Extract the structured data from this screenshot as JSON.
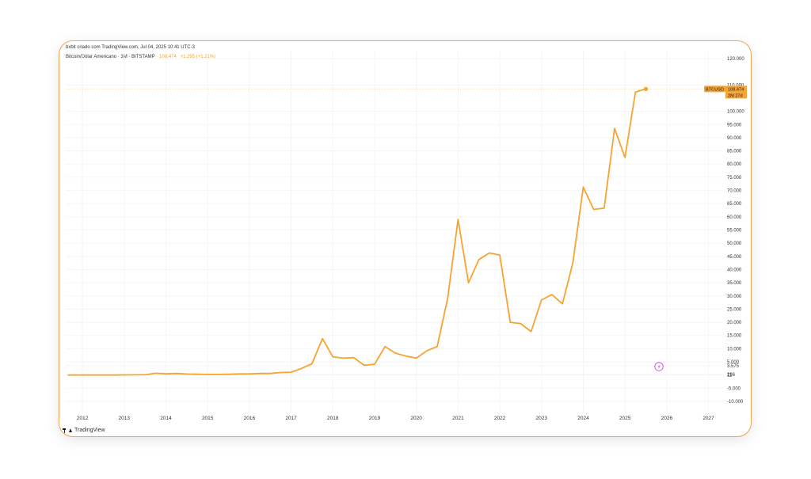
{
  "header": {
    "created": "bxbit criado com TradingView.com, Jul 04, 2025 10:41 UTC-3",
    "symbol_desc": "Bitcoin/Dólar Americano · 3M · BITSTAMP",
    "price": "108.474",
    "change": "+1.295 (+1.21%)"
  },
  "badge": {
    "symbol": "BTCUSD",
    "price": "108.474",
    "countdown": "2M 27d"
  },
  "brand": "TradingView",
  "colors": {
    "series": "#f7a330",
    "grid": "#f2f3f5",
    "badge_bg": "#f7a330",
    "card_border": "#f0a55a"
  },
  "icons": {
    "flash": "lightning-icon"
  },
  "chart_data": {
    "type": "line",
    "x_ticks": [
      "2012",
      "2013",
      "2014",
      "2015",
      "2016",
      "2017",
      "2018",
      "2019",
      "2020",
      "2021",
      "2022",
      "2023",
      "2024",
      "2025",
      "2026",
      "2027"
    ],
    "y_ticks": [
      "120.000",
      "110.000",
      "100.000",
      "95.000",
      "90.000",
      "85.000",
      "80.000",
      "75.000",
      "70.000",
      "65.000",
      "60.000",
      "55.000",
      "50.000",
      "45.000",
      "40.000",
      "35.000",
      "30.000",
      "25.000",
      "20.000",
      "15.000",
      "10.000",
      "5.000",
      "3.575",
      "236",
      "11",
      "-5.000",
      "-10.000"
    ],
    "xlim": [
      2011.6,
      2027.35
    ],
    "ylim": [
      -13000,
      123000
    ],
    "series": [
      {
        "values": [
          [
            2011.65,
            5
          ],
          [
            2012.0,
            5
          ],
          [
            2012.25,
            5
          ],
          [
            2012.5,
            7
          ],
          [
            2012.75,
            10
          ],
          [
            2013.0,
            50
          ],
          [
            2013.25,
            100
          ],
          [
            2013.5,
            100
          ],
          [
            2013.75,
            700
          ],
          [
            2014.0,
            450
          ],
          [
            2014.25,
            600
          ],
          [
            2014.5,
            400
          ],
          [
            2014.75,
            300
          ],
          [
            2015.0,
            250
          ],
          [
            2015.25,
            240
          ],
          [
            2015.5,
            300
          ],
          [
            2015.75,
            420
          ],
          [
            2016.0,
            430
          ],
          [
            2016.25,
            600
          ],
          [
            2016.5,
            600
          ],
          [
            2016.75,
            960
          ],
          [
            2017.0,
            1070
          ],
          [
            2017.25,
            2500
          ],
          [
            2017.5,
            4300
          ],
          [
            2017.75,
            13800
          ],
          [
            2018.0,
            6900
          ],
          [
            2018.25,
            6400
          ],
          [
            2018.5,
            6600
          ],
          [
            2018.75,
            3700
          ],
          [
            2019.0,
            4100
          ],
          [
            2019.25,
            10800
          ],
          [
            2019.5,
            8300
          ],
          [
            2019.75,
            7200
          ],
          [
            2020.0,
            6400
          ],
          [
            2020.25,
            9200
          ],
          [
            2020.5,
            10800
          ],
          [
            2020.75,
            29000
          ],
          [
            2021.0,
            59000
          ],
          [
            2021.25,
            35000
          ],
          [
            2021.5,
            43800
          ],
          [
            2021.75,
            46300
          ],
          [
            2022.0,
            45500
          ],
          [
            2022.25,
            20000
          ],
          [
            2022.5,
            19500
          ],
          [
            2022.75,
            16500
          ],
          [
            2023.0,
            28500
          ],
          [
            2023.25,
            30500
          ],
          [
            2023.5,
            27000
          ],
          [
            2023.75,
            42500
          ],
          [
            2024.0,
            71300
          ],
          [
            2024.25,
            62800
          ],
          [
            2024.5,
            63300
          ],
          [
            2024.75,
            93500
          ],
          [
            2025.0,
            82500
          ],
          [
            2025.25,
            107300
          ],
          [
            2025.5,
            108474
          ]
        ]
      }
    ],
    "grid": true,
    "last_value": 108474
  }
}
